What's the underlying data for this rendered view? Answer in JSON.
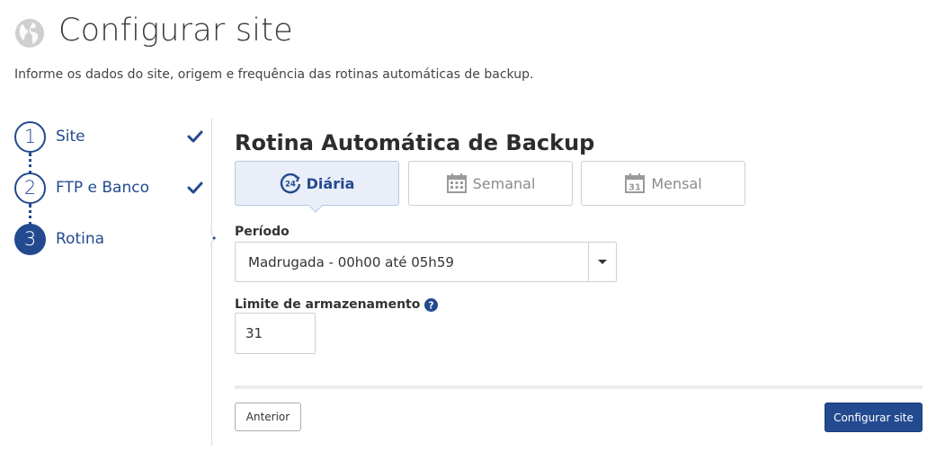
{
  "header": {
    "title": "Configurar site",
    "subtitle": "Informe os dados do site, origem e frequência das rotinas automáticas de backup.",
    "icon": "globe-icon"
  },
  "steps": [
    {
      "number": "1",
      "label": "Site",
      "status": "done"
    },
    {
      "number": "2",
      "label": "FTP e Banco",
      "status": "done"
    },
    {
      "number": "3",
      "label": "Rotina",
      "status": "active"
    }
  ],
  "section": {
    "title": "Rotina Automática de Backup"
  },
  "frequency": {
    "tabs": [
      {
        "label": "Diária",
        "icon": "24h-icon",
        "selected": true
      },
      {
        "label": "Semanal",
        "icon": "calendar-icon",
        "selected": false
      },
      {
        "label": "Mensal",
        "icon": "calendar-31-icon",
        "selected": false
      }
    ],
    "calendar_day": "31",
    "badge_24": "24"
  },
  "periodo": {
    "label": "Período",
    "value": "Madrugada - 00h00 até 05h59"
  },
  "limite": {
    "label": "Limite de armazenamento",
    "value": "31"
  },
  "actions": {
    "prev_label": "Anterior",
    "submit_label": "Configurar site"
  },
  "colors": {
    "primary": "#234a8f",
    "tab_selected_bg": "#e9eef8",
    "border": "#cfcfcf"
  }
}
